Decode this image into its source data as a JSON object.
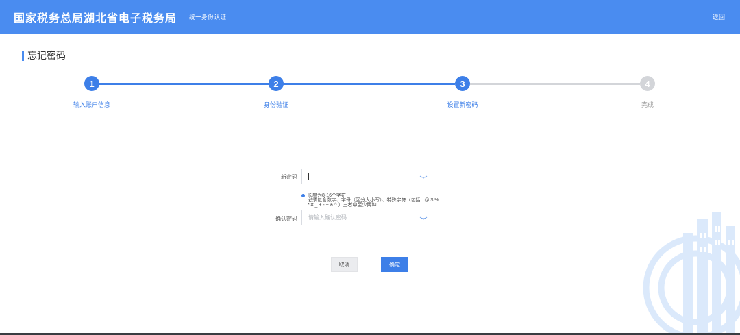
{
  "header": {
    "brand": "国家税务总局湖北省电子税务局",
    "subtitle": "统一身份认证",
    "back_label": "返回"
  },
  "page": {
    "title": "忘记密码"
  },
  "steps": [
    {
      "number": "1",
      "label": "输入账户信息",
      "state": "active"
    },
    {
      "number": "2",
      "label": "身份验证",
      "state": "active"
    },
    {
      "number": "3",
      "label": "设置新密码",
      "state": "active"
    },
    {
      "number": "4",
      "label": "完成",
      "state": "todo"
    }
  ],
  "form": {
    "new_password": {
      "label": "新密码",
      "value": "",
      "placeholder": ""
    },
    "hint": {
      "line1": "长度为8-16个字符",
      "line2": "必须包含数字、字母（区分大小写）、特殊字符（包括 . @ $ %",
      "line3": "* # _ + - ~ & ^ ）三者中至少两种"
    },
    "confirm_password": {
      "label": "确认密码",
      "value": "",
      "placeholder": "请输入确认密码"
    }
  },
  "buttons": {
    "cancel": "取消",
    "confirm": "确定"
  },
  "colors": {
    "primary": "#4a8cf0",
    "step_active": "#3d7fe8",
    "step_todo": "#d3d5d9"
  }
}
